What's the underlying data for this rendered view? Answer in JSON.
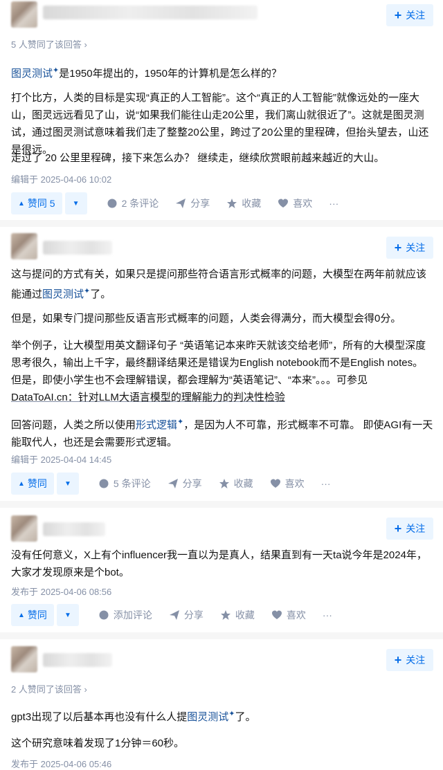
{
  "common": {
    "follow": "关注",
    "share": "分享",
    "favorite": "收藏",
    "like": "喜欢",
    "more": "···"
  },
  "answers": [
    {
      "upvote_note": "5 人赞同了该回答 ›",
      "p1_link": "图灵测试",
      "p1_rest": "是1950年提出的，1950年的计算机是怎么样的？",
      "p2": "打个比方，人类的目标是实现“真正的人工智能”。这个“真正的人工智能”就像远处的一座大山，图灵远远看见了山，说“如果我们能往山走20公里，我们离山就很近了”。这就是图灵测试，通过图灵测试意味着我们走了整整20公里，跨过了20公里的里程碑，但抬头望去，山还是很远。",
      "p3": "走过了 20 公里里程碑，接下来怎么办？ 继续走，继续欣赏眼前越来越近的大山。",
      "edited": "编辑于 2025-04-06 10:02",
      "vote": "赞同 5",
      "comments": "2 条评论"
    },
    {
      "p1_a": "这与提问的方式有关，如果只是提问那些符合语言形式概率的问题，大模型在两年前就应该能通过",
      "p1_link": "图灵测试",
      "p1_b": "了。",
      "p2": "但是，如果专门提问那些反语言形式概率的问题，人类会得满分，而大模型会得0分。",
      "p3_a": "举个例子，让大模型用英文翻译句子 “英语笔记本来昨天就该交给老师”，所有的大模型深度思考很久，输出上千字，最终翻译结果还是错误为English notebook而不是English notes。但是，即使小学生也不会理解错误，都会理解为“英语笔记”、“本来”。。。可参见",
      "p3_link": "DataToAI.cn：针对LLM大语言模型的理解能力的判决性检验",
      "p4_a": "回答问题，人类之所以使用",
      "p4_link": "形式逻辑",
      "p4_b": "，是因为人不可靠，形式概率不可靠。 即使AGI有一天能取代人，也还是会需要形式逻辑。",
      "edited": "编辑于 2025-04-04 14:45",
      "vote": "赞同",
      "comments": "5 条评论"
    },
    {
      "p1": "没有任何意义，X上有个influencer我一直以为是真人，结果直到有一天ta说今年是2024年，大家才发现原来是个bot。",
      "edited": "发布于 2025-04-06 08:56",
      "vote": "赞同",
      "comments": "添加评论"
    },
    {
      "upvote_note": "2 人赞同了该回答 ›",
      "p1_a": "gpt3出现了以后基本再也没有什么人提",
      "p1_link": "图灵测试",
      "p1_b": "了。",
      "p2": "这个研究意味着发现了1分钟＝60秒。",
      "edited": "发布于 2025-04-06 05:46"
    }
  ]
}
